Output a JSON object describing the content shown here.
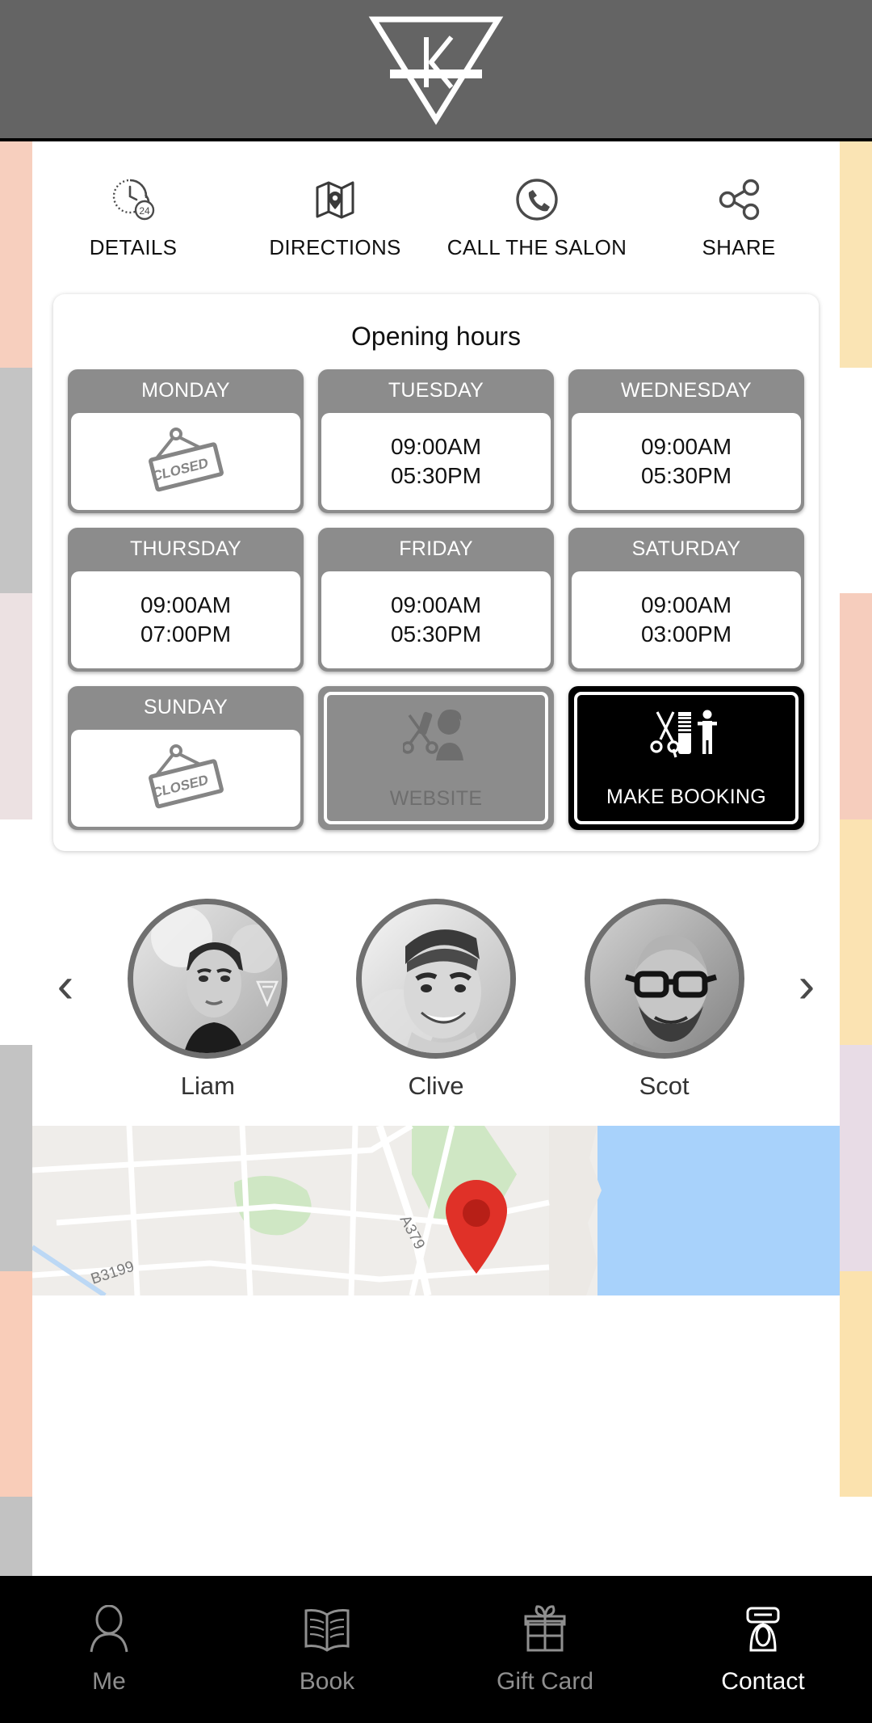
{
  "header": {
    "logo_icon": "inverted-triangle-k-logo",
    "background_color": "#646464"
  },
  "actions": [
    {
      "label": "DETAILS",
      "icon": "clock-24-icon"
    },
    {
      "label": "DIRECTIONS",
      "icon": "map-pin-icon"
    },
    {
      "label": "CALL THE SALON",
      "icon": "phone-circle-icon"
    },
    {
      "label": "SHARE",
      "icon": "share-nodes-icon"
    }
  ],
  "opening_hours": {
    "title": "Opening hours",
    "closed_sign_text": "CLOSED",
    "days": [
      {
        "name": "MONDAY",
        "closed": true,
        "open": "",
        "close": ""
      },
      {
        "name": "TUESDAY",
        "closed": false,
        "open": "09:00AM",
        "close": "05:30PM"
      },
      {
        "name": "WEDNESDAY",
        "closed": false,
        "open": "09:00AM",
        "close": "05:30PM"
      },
      {
        "name": "THURSDAY",
        "closed": false,
        "open": "09:00AM",
        "close": "07:00PM"
      },
      {
        "name": "FRIDAY",
        "closed": false,
        "open": "09:00AM",
        "close": "05:30PM"
      },
      {
        "name": "SATURDAY",
        "closed": false,
        "open": "09:00AM",
        "close": "03:00PM"
      },
      {
        "name": "SUNDAY",
        "closed": true,
        "open": "",
        "close": ""
      }
    ]
  },
  "buttons": {
    "website": {
      "label": "WEBSITE",
      "icon": "barber-scissors-person-icon",
      "bg": "#8c8c8c",
      "text_color": "#6e6e6e"
    },
    "booking": {
      "label": "MAKE BOOKING",
      "icon": "scissors-comb-person-icon",
      "bg": "#000000",
      "text_color": "#ffffff"
    }
  },
  "staff": {
    "prev_arrow": "‹",
    "next_arrow": "›",
    "members": [
      {
        "name": "Liam"
      },
      {
        "name": "Clive"
      },
      {
        "name": "Scot"
      }
    ]
  },
  "map": {
    "road_labels": [
      "A379",
      "B3199"
    ],
    "pin_color": "#e03128",
    "water_color": "#a8d2fb",
    "land_color": "#efedea",
    "park_color": "#cfe7c4"
  },
  "bottom_nav": {
    "items": [
      {
        "label": "Me",
        "icon": "person-icon",
        "active": false
      },
      {
        "label": "Book",
        "icon": "open-book-icon",
        "active": false
      },
      {
        "label": "Gift Card",
        "icon": "gift-box-icon",
        "active": false
      },
      {
        "label": "Contact",
        "icon": "telephone-icon",
        "active": true
      }
    ]
  },
  "background_bands": {
    "left": [
      "#f7cfbe",
      "#c4c4c4",
      "#ece1e2",
      "#ffffff",
      "#c3c3c3",
      "#f9cdb9",
      "#c2c2c2"
    ],
    "right": [
      "#fae4b4",
      "#ffffff",
      "#f6cdbd",
      "#fbe3b2",
      "#e8dce6",
      "#fbe2ae",
      "#ffffff"
    ]
  }
}
